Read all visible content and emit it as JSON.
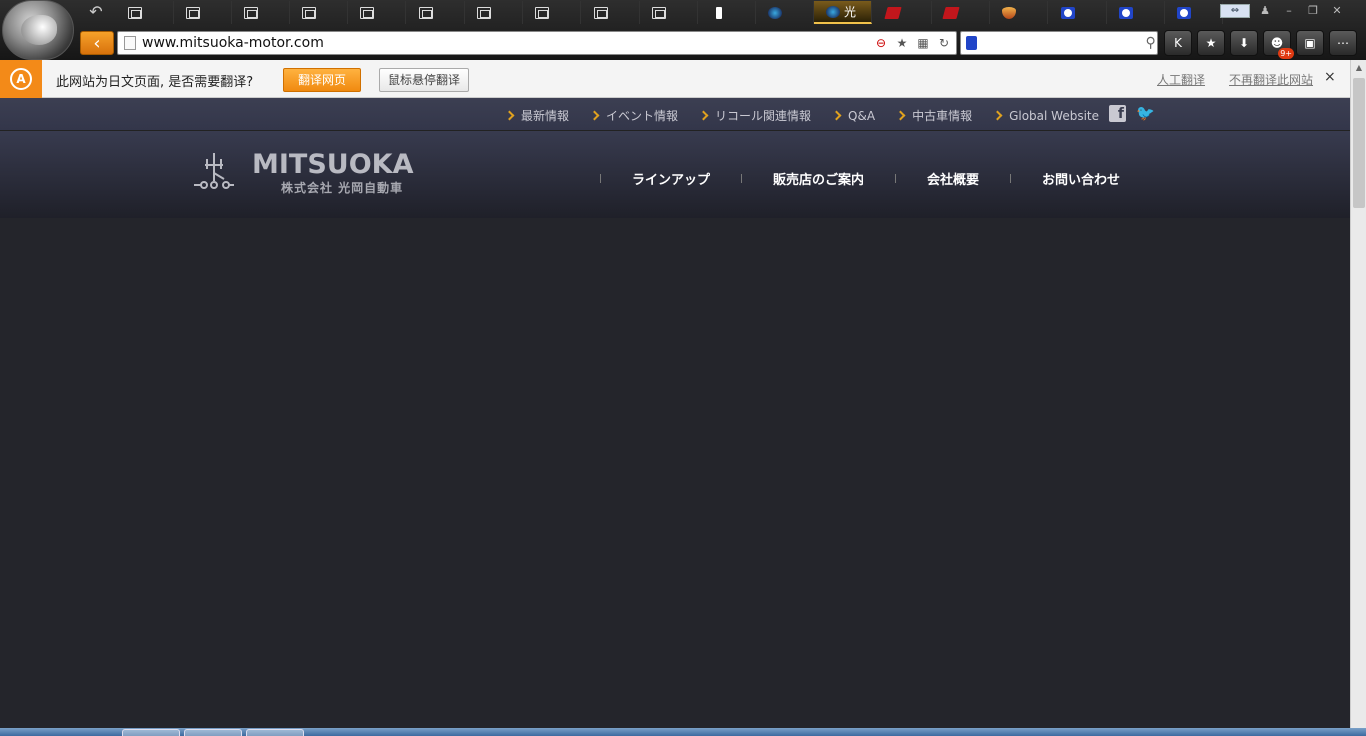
{
  "browser": {
    "tabs": [
      {
        "label": "",
        "icon": "page-icon"
      },
      {
        "label": "",
        "icon": "page-icon"
      },
      {
        "label": "",
        "icon": "page-icon"
      },
      {
        "label": "",
        "icon": "page-icon"
      },
      {
        "label": "",
        "icon": "page-icon"
      },
      {
        "label": "",
        "icon": "page-icon"
      },
      {
        "label": "",
        "icon": "page-icon"
      },
      {
        "label": "",
        "icon": "page-icon"
      },
      {
        "label": "",
        "icon": "page-icon"
      },
      {
        "label": "",
        "icon": "page-icon"
      },
      {
        "label": "",
        "icon": "bolt-icon"
      },
      {
        "label": "",
        "icon": "globe-icon"
      },
      {
        "label": "光",
        "icon": "mitsuoka-icon",
        "active": true
      },
      {
        "label": "",
        "icon": "red-brand-icon"
      },
      {
        "label": "",
        "icon": "red-brand-icon"
      },
      {
        "label": "",
        "icon": "gem-icon"
      },
      {
        "label": "",
        "icon": "paw-icon"
      },
      {
        "label": "",
        "icon": "paw-icon"
      },
      {
        "label": "",
        "icon": "paw-icon"
      }
    ],
    "url": "www.mitsuoka-motor.com",
    "search_placeholder": "",
    "accent": "#f08a10"
  },
  "translate_bar": {
    "message": "此网站为日文页面, 是否需要翻译?",
    "translate_button": "翻译网页",
    "hover_button": "鼠标悬停翻译",
    "manual_link": "人工翻译",
    "never_link": "不再翻译此网站",
    "close": "×"
  },
  "site": {
    "util_links": [
      "最新情報",
      "イベント情報",
      "リコール関連情報",
      "Q&A",
      "中古車情報",
      "Global Website"
    ],
    "brand": {
      "name": "MITSUOKA",
      "sub": "株式会社 光岡自動車"
    },
    "main_nav": [
      "ラインアップ",
      "販売店のご案内",
      "会社概要",
      "お問い合わせ"
    ]
  },
  "toolbar": {
    "badge": "9+"
  }
}
